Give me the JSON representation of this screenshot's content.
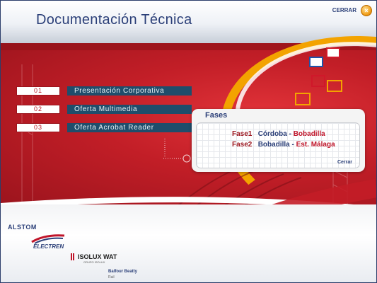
{
  "header": {
    "title": "Documentación Técnica",
    "close_label": "CERRAR",
    "close_icon_glyph": "×"
  },
  "menu": [
    {
      "num": "01",
      "label": "Presentación Corporativa"
    },
    {
      "num": "02",
      "label": "Oferta Multimedia"
    },
    {
      "num": "03",
      "label": "Oferta Acrobat Reader"
    }
  ],
  "fases": {
    "title": "Fases",
    "rows": [
      {
        "num": "Fase1",
        "from": "Córdoba",
        "sep": " - ",
        "to": "Bobadilla"
      },
      {
        "num": "Fase2",
        "from": "Bobadilla",
        "sep": " - ",
        "to": "Est. Málaga"
      }
    ],
    "close_label": "Cerrar"
  },
  "logos": {
    "alstom": "ALSTOM",
    "electren": "ELECTREN",
    "isolux": "ISOLUX WAT",
    "isolux_sub": "GRUPO ISOLUX",
    "balfour": "Balfour Beatty",
    "balfour_sub": "Rail"
  },
  "colors": {
    "brand_blue": "#2b3f78",
    "brand_red": "#b51b26",
    "accent_orange": "#f3a300",
    "menu_bar": "#1f4d6b"
  }
}
